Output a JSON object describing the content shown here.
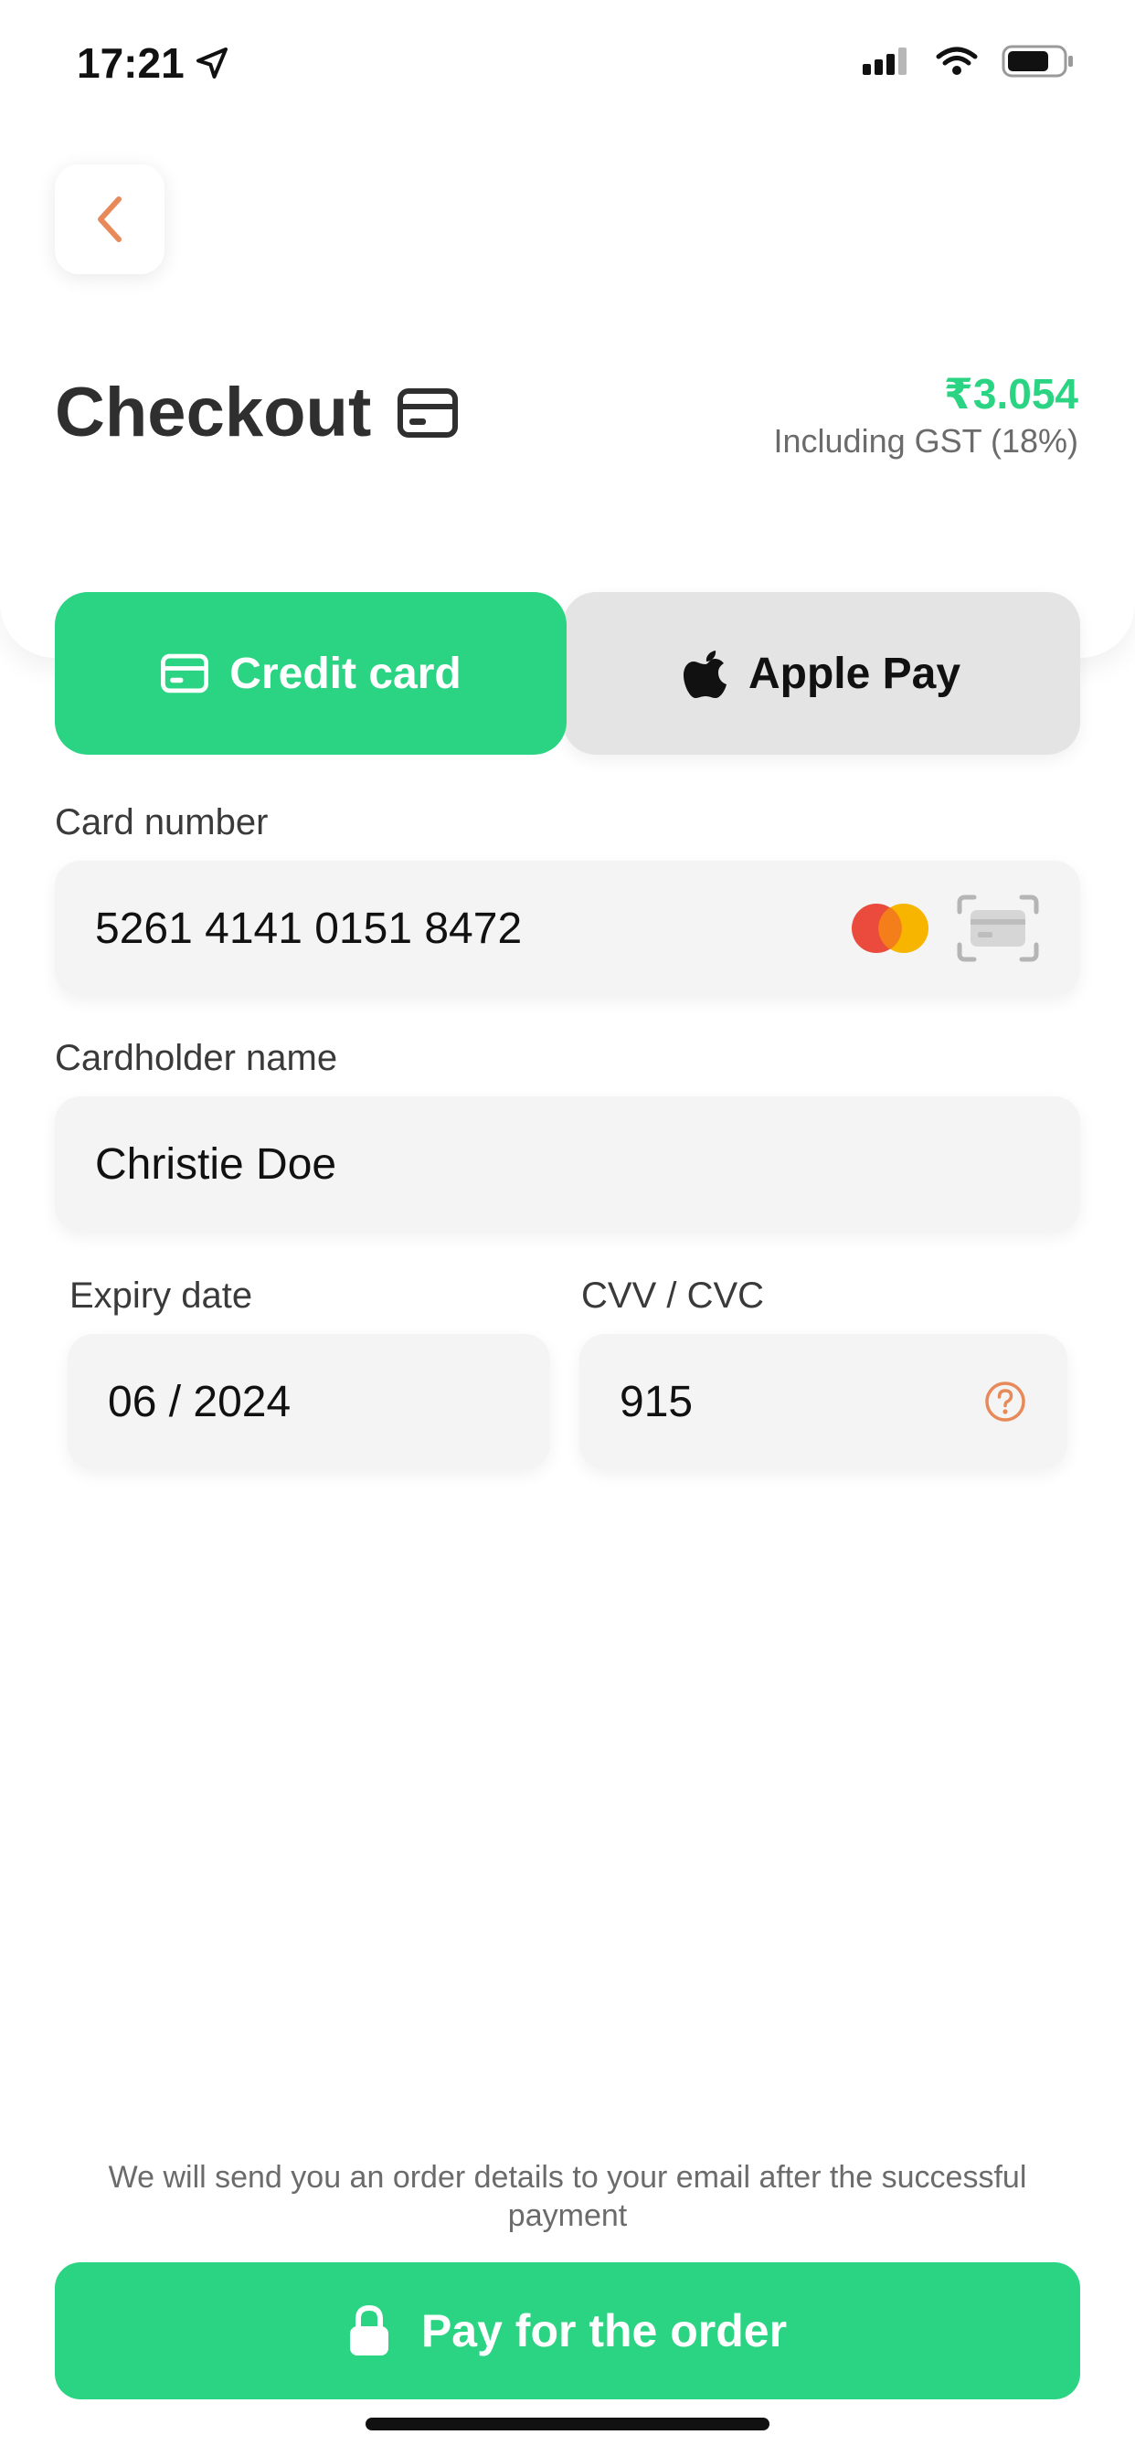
{
  "status_bar": {
    "time": "17:21"
  },
  "header": {
    "title": "Checkout",
    "price": "₹3.054",
    "tax_note": "Including GST (18%)"
  },
  "payment_methods": {
    "credit_card_label": "Credit card",
    "apple_pay_label": "Apple Pay"
  },
  "form": {
    "card_number_label": "Card number",
    "card_number_value": "5261 4141 0151 8472",
    "cardholder_label": "Cardholder name",
    "cardholder_value": "Christie Doe",
    "expiry_label": "Expiry date",
    "expiry_value": "06 / 2024",
    "cvv_label": "CVV / CVC",
    "cvv_value": "915"
  },
  "footer": {
    "note": "We will send you an order details to your email after the successful payment",
    "pay_button_label": "Pay for the order"
  },
  "colors": {
    "accent_green": "#2bd483",
    "back_chevron": "#e8895a",
    "help_icon": "#e8895a"
  },
  "icons": {
    "back": "chevron-left-icon",
    "title": "credit-card-icon",
    "apple": "apple-icon",
    "mastercard": "mastercard-icon",
    "scan": "scan-card-icon",
    "help": "help-circle-icon",
    "lock": "lock-icon"
  }
}
